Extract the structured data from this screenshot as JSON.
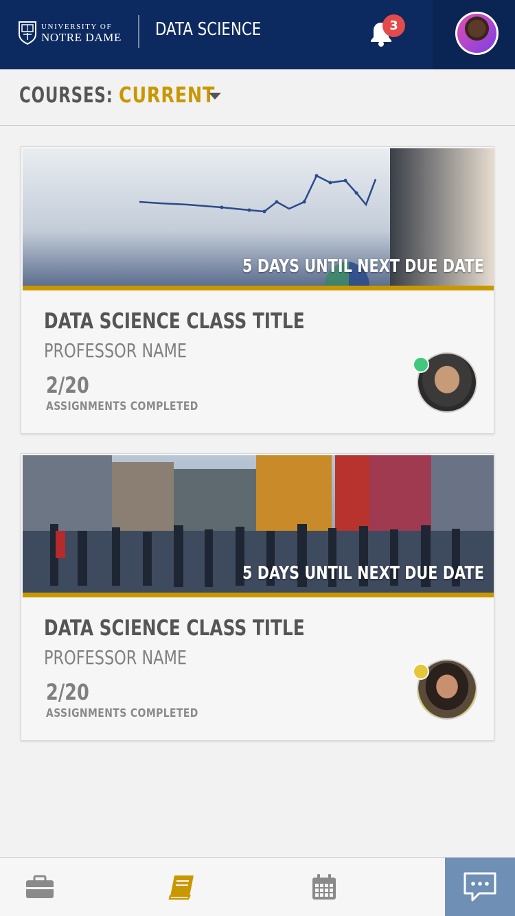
{
  "header": {
    "logo_line1": "UNIVERSITY OF",
    "logo_line2": "NOTRE DAME",
    "app_title": "DATA SCIENCE",
    "notification_count": "3",
    "colors": {
      "navy": "#0c2a60",
      "gold": "#c99700",
      "badge": "#e34b4b"
    }
  },
  "filter": {
    "label": "COURSES:",
    "value": "CURRENT"
  },
  "courses": [
    {
      "due_text": "5 DAYS UNTIL NEXT DUE DATE",
      "title": "DATA SCIENCE CLASS TITLE",
      "professor": "PROFESSOR NAME",
      "count": "2/20",
      "count_label": "ASSIGNMENTS COMPLETED",
      "status_color": "#3fc87e",
      "image": "chart-on-monitor"
    },
    {
      "due_text": "5 DAYS UNTIL NEXT DUE DATE",
      "title": "DATA SCIENCE CLASS TITLE",
      "professor": "PROFESSOR NAME",
      "count": "2/20",
      "count_label": "ASSIGNMENTS COMPLETED",
      "status_color": "#e6c63a",
      "image": "city-crosswalk-crowd"
    }
  ],
  "tabs": [
    {
      "name": "portfolio",
      "icon": "briefcase-icon",
      "active": false
    },
    {
      "name": "courses",
      "icon": "book-icon",
      "active": true
    },
    {
      "name": "calendar",
      "icon": "calendar-icon",
      "active": false
    },
    {
      "name": "chat",
      "icon": "chat-icon",
      "active": false
    }
  ]
}
